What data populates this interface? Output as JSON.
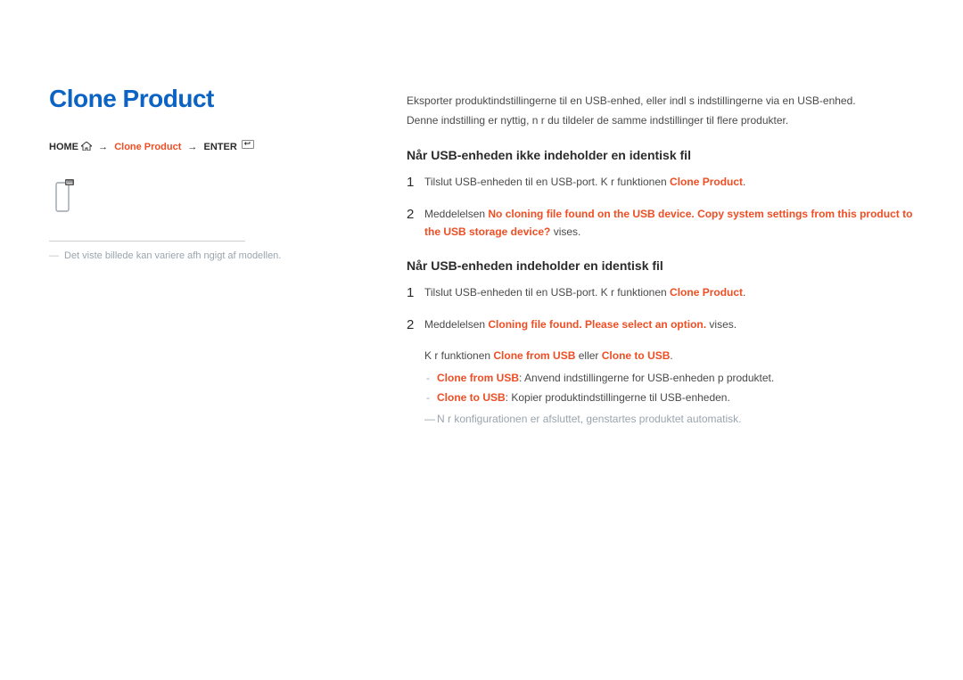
{
  "title": "Clone Product",
  "breadcrumb": {
    "home": "HOME",
    "arrow": "→",
    "item": "Clone Product",
    "enter": "ENTER"
  },
  "caption_dash": "―",
  "caption": "Det viste billede kan variere afh ngigt af modellen.",
  "intro_line1": "Eksporter produktindstillingerne til en USB-enhed, eller indl s indstillingerne via en USB-enhed.",
  "intro_line2": "Denne indstilling er nyttig, n r du tildeler de samme indstillinger til flere produkter.",
  "sectionA": {
    "heading": "Når USB-enheden ikke indeholder en identisk fil",
    "step1_num": "1",
    "step1_a": "Tilslut USB-enheden til en USB-port. K r funktionen ",
    "step1_b": "Clone Product",
    "step1_c": ".",
    "step2_num": "2",
    "step2_a": "Meddelelsen ",
    "step2_b": "No cloning file found on the USB device. Copy system settings from this product to the USB storage device?",
    "step2_c": " vises."
  },
  "sectionB": {
    "heading": "Når USB-enheden indeholder en identisk fil",
    "step1_num": "1",
    "step1_a": "Tilslut USB-enheden til en USB-port. K r funktionen ",
    "step1_b": "Clone Product",
    "step1_c": ".",
    "step2_num": "2",
    "step2_a": "Meddelelsen ",
    "step2_b": "Cloning file found. Please select an option.",
    "step2_c": " vises.",
    "sub_a": "K r funktionen ",
    "sub_b": "Clone from USB",
    "sub_c": " eller ",
    "sub_d": "Clone to USB",
    "sub_e": ".",
    "d1_a": "Clone from USB",
    "d1_b": ": Anvend indstillingerne for USB-enheden p  produktet.",
    "d2_a": "Clone to USB",
    "d2_b": ": Kopier produktindstillingerne til USB-enheden.",
    "note": "N r konfigurationen er afsluttet, genstartes produktet automatisk."
  }
}
